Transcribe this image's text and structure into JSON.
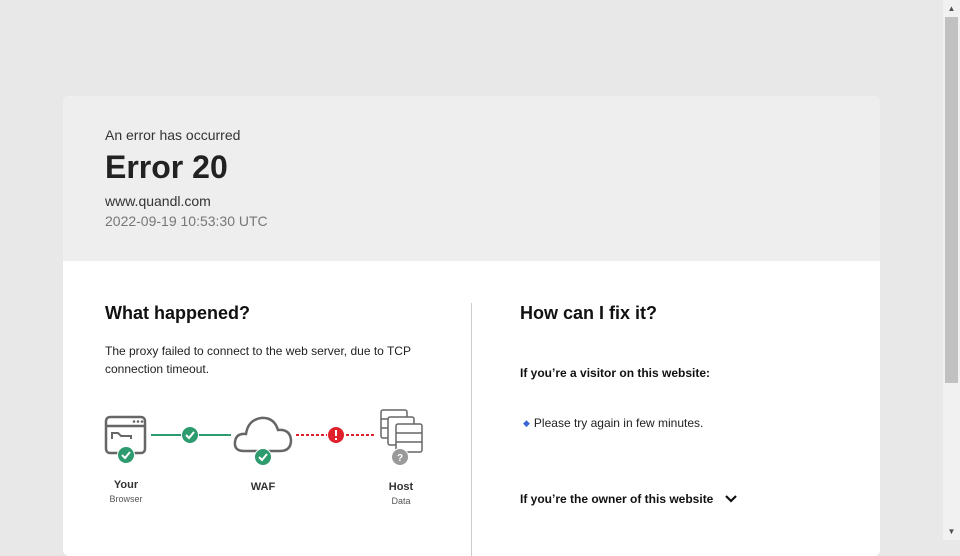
{
  "header": {
    "subtitle": "An error has occurred",
    "title": "Error 20",
    "domain": "www.quandl.com",
    "timestamp": "2022-09-19 10:53:30 UTC"
  },
  "what_happened": {
    "heading": "What happened?",
    "description": "The proxy failed to connect to the web server, due to TCP connection timeout."
  },
  "diagram": {
    "nodes": [
      {
        "label": "Your",
        "sublabel": "Browser",
        "icon": "browser-icon",
        "status": "ok"
      },
      {
        "label": "WAF",
        "sublabel": "",
        "icon": "cloud-icon",
        "status": "ok"
      },
      {
        "label": "Host",
        "sublabel": "Data",
        "icon": "server-icon",
        "status": "unknown"
      }
    ],
    "links": [
      {
        "status": "ok"
      },
      {
        "status": "error"
      }
    ],
    "colors": {
      "ok": "#2e9b6f",
      "error": "#e0212b",
      "unknown": "#9a9a9a",
      "icon": "#666666"
    }
  },
  "how_to_fix": {
    "heading": "How can I fix it?",
    "visitor_heading": "If you’re a visitor on this website:",
    "visitor_tip": "Please try again in few minutes.",
    "owner_heading": "If you’re the owner of this website"
  },
  "icons": {
    "bullet": "blue-diamond-icon",
    "expand": "chevron-down-icon"
  }
}
